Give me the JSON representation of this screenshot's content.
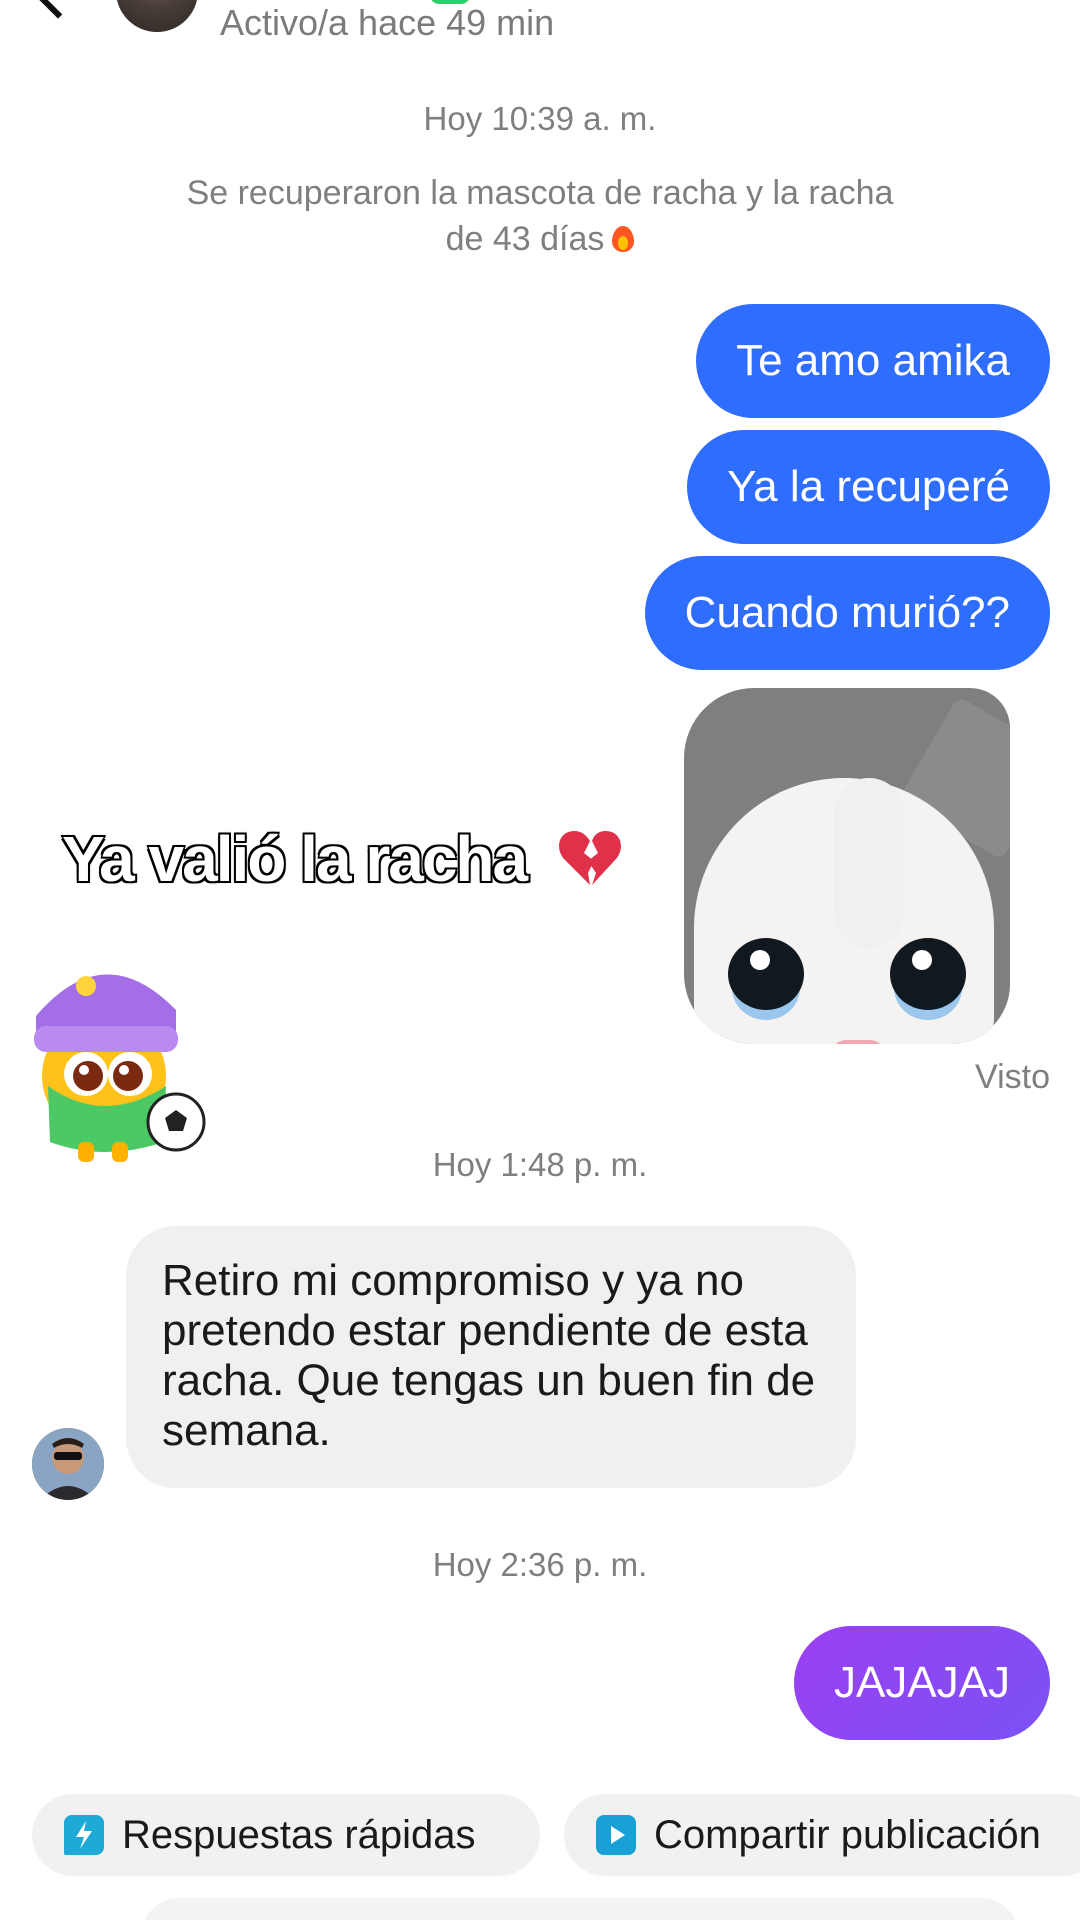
{
  "header": {
    "active_status": "Activo/a hace 49 min"
  },
  "conversation": {
    "timestamp_1": "Hoy 10:39 a. m.",
    "system_note_line1": "Se recuperaron la mascota de racha y la racha",
    "system_note_line2": "de 43 días",
    "outgoing_1": "Te amo amika",
    "outgoing_2": "Ya la recuperé",
    "outgoing_3": "Cuando murió??",
    "overlay_caption": "Ya valió la racha",
    "seen_label": "Visto",
    "timestamp_2": "Hoy 1:48 p. m.",
    "incoming_1": "Retiro mi compromiso y ya no pretendo estar pendiente de esta racha. Que tengas un buen fin de semana.",
    "timestamp_3": "Hoy 2:36 p. m.",
    "outgoing_4": "JAJAJAJ"
  },
  "quick_actions": {
    "quick_replies": "Respuestas rápidas",
    "share_post": "Compartir publicación"
  },
  "icons": {
    "back": "chevron-left-icon",
    "fire": "fire-icon",
    "broken_heart": "broken-heart-icon",
    "quick_replies": "lightning-chat-icon",
    "share_post": "play-icon"
  },
  "colors": {
    "outgoing_bubble": "#2f6dff",
    "outgoing_bubble_purple": "#8a48f3",
    "incoming_bubble": "#f0f0f0",
    "muted_text": "#7f7f7f"
  }
}
